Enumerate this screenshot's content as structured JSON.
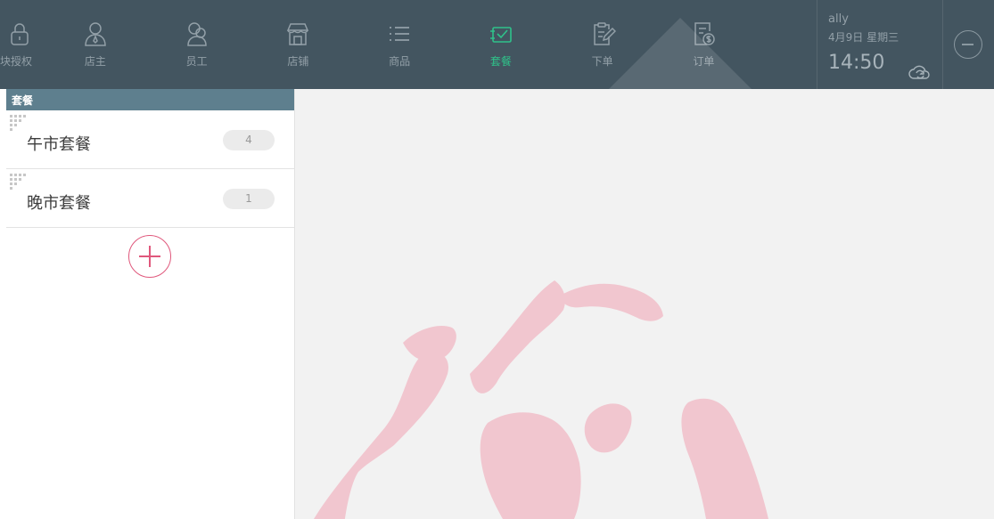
{
  "nav": {
    "items": [
      {
        "label": "块授权",
        "icon": "lock-icon",
        "active": false
      },
      {
        "label": "店主",
        "icon": "person-icon",
        "active": false
      },
      {
        "label": "员工",
        "icon": "people-icon",
        "active": false
      },
      {
        "label": "店铺",
        "icon": "store-icon",
        "active": false
      },
      {
        "label": "商品",
        "icon": "list-icon",
        "active": false
      },
      {
        "label": "套餐",
        "icon": "package-icon",
        "active": true
      },
      {
        "label": "下单",
        "icon": "clipboard-edit-icon",
        "active": false
      },
      {
        "label": "订单",
        "icon": "receipt-icon",
        "active": false
      }
    ],
    "active_color": "#2fc28a",
    "bar_color": "#435560"
  },
  "user": {
    "name": "ally",
    "date": "4月9日 星期三",
    "time": "14:50",
    "sync_icon": "cloud-sync-icon"
  },
  "exit_icon": "minus-circle-icon",
  "sidebar": {
    "header": "套餐",
    "sets": [
      {
        "name": "午市套餐",
        "count": "4"
      },
      {
        "name": "晚市套餐",
        "count": "1"
      }
    ],
    "add_icon": "plus-circle-icon",
    "accent": "#e0587c"
  },
  "main": {
    "watermark_icon": "brand-logo-watermark"
  }
}
